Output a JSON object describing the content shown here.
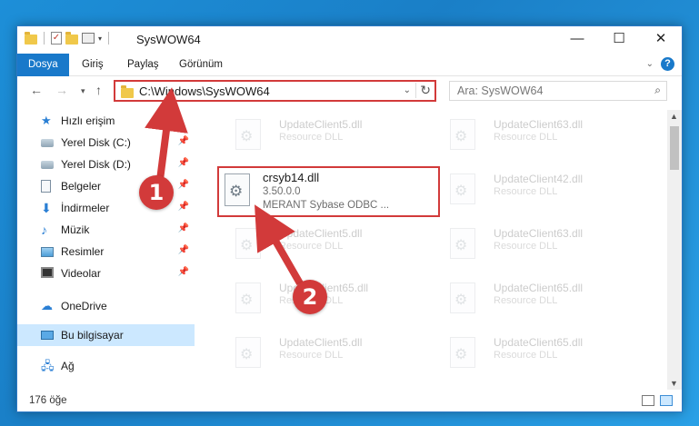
{
  "window": {
    "title": "SysWOW64",
    "controls": {
      "minimize": "—",
      "maximize": "☐",
      "close": "✕"
    }
  },
  "ribbon": {
    "tabs": [
      "Dosya",
      "Giriş",
      "Paylaş",
      "Görünüm"
    ],
    "active_tab": "Dosya"
  },
  "nav": {
    "address": "C:\\Windows\\SysWOW64",
    "search_placeholder": "Ara: SysWOW64"
  },
  "sidebar": {
    "items": [
      {
        "label": "Hızlı erişim",
        "icon": "star-icon",
        "pinned": false
      },
      {
        "label": "Yerel Disk (C:)",
        "icon": "drive-icon",
        "pinned": true
      },
      {
        "label": "Yerel Disk (D:)",
        "icon": "drive-icon",
        "pinned": true
      },
      {
        "label": "Belgeler",
        "icon": "document-icon",
        "pinned": true
      },
      {
        "label": "İndirmeler",
        "icon": "download-icon",
        "pinned": true
      },
      {
        "label": "Müzik",
        "icon": "music-icon",
        "pinned": true
      },
      {
        "label": "Resimler",
        "icon": "pictures-icon",
        "pinned": true
      },
      {
        "label": "Videolar",
        "icon": "videos-icon",
        "pinned": true
      },
      {
        "label": "OneDrive",
        "icon": "cloud-icon",
        "pinned": false
      },
      {
        "label": "Bu bilgisayar",
        "icon": "computer-icon",
        "pinned": false
      },
      {
        "label": "Ağ",
        "icon": "network-icon",
        "pinned": false
      }
    ]
  },
  "files": {
    "left": [
      {
        "name": "UpdateClient5.dll",
        "desc": "Resource DLL"
      },
      {
        "name": "UpdateClient5.dll",
        "desc": "Resource DLL"
      },
      {
        "name": "UpdateClient65.dll",
        "desc": "Resource DLL"
      },
      {
        "name": "UpdateClient5.dll",
        "desc": "Resource DLL"
      }
    ],
    "right": [
      {
        "name": "UpdateClient63.dll",
        "desc": "Resource DLL"
      },
      {
        "name": "UpdateClient42.dll",
        "desc": "Resource DLL"
      },
      {
        "name": "UpdateClient63.dll",
        "desc": "Resource DLL"
      },
      {
        "name": "UpdateClient65.dll",
        "desc": "Resource DLL"
      },
      {
        "name": "UpdateClient65.dll",
        "desc": "Resource DLL"
      }
    ],
    "highlighted": {
      "name": "crsyb14.dll",
      "version": "3.50.0.0",
      "desc": "MERANT Sybase ODBC ..."
    }
  },
  "status": {
    "count": "176 öğe"
  },
  "annotations": {
    "badge1": "1",
    "badge2": "2",
    "color": "#d23a3a"
  }
}
